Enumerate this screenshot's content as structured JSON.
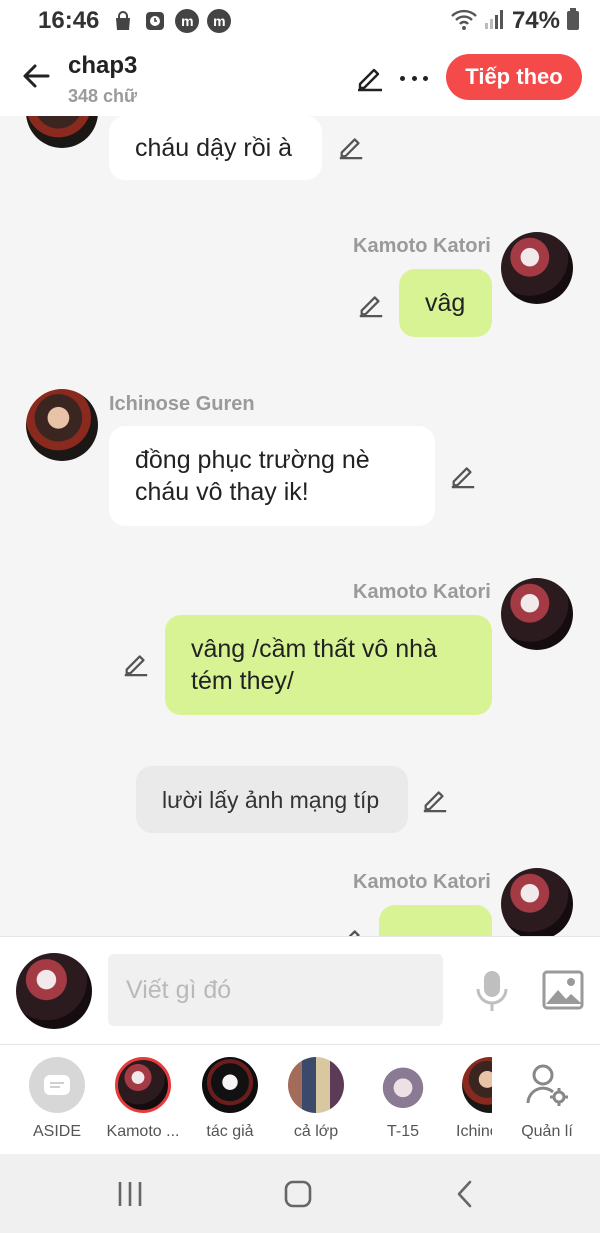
{
  "status_bar": {
    "time": "16:46",
    "battery": "74%",
    "icons": [
      "shopping-bag-icon",
      "clock-app-icon",
      "m-app-icon",
      "m-app-icon-2",
      "wifi-icon",
      "signal-icon",
      "battery-icon"
    ],
    "m_glyph": "m"
  },
  "header": {
    "title": "chap3",
    "word_count": "348 chữ",
    "next_label": "Tiếp theo",
    "next_color": "#f44a4a"
  },
  "messages": [
    {
      "side": "left",
      "sender": "",
      "text": "cháu dậy rồi à",
      "style": "white"
    },
    {
      "side": "right",
      "sender": "Kamoto Katori",
      "text": "vâg",
      "style": "green"
    },
    {
      "side": "left",
      "sender": "Ichinose Guren",
      "text_lines": [
        "đồng phục trường nè",
        "cháu vô thay ik!"
      ],
      "style": "white"
    },
    {
      "side": "right",
      "sender": "Kamoto Katori",
      "text_lines": [
        "vâng /cầm thất vô nhà",
        "tém they/"
      ],
      "style": "green"
    },
    {
      "side": "center",
      "sender": "",
      "text": "lười lấy ảnh mạng típ",
      "style": "gray"
    },
    {
      "side": "right",
      "sender": "Kamoto Katori",
      "text": "",
      "style": "green"
    }
  ],
  "composer": {
    "placeholder": "Viết gì đó"
  },
  "characters": [
    {
      "label": "ASIDE"
    },
    {
      "label": "Kamoto ..."
    },
    {
      "label": "tác giả"
    },
    {
      "label": "cả lớp"
    },
    {
      "label": "T-15"
    },
    {
      "label": "Ichinose"
    },
    {
      "label": "Quản lí"
    }
  ],
  "colors": {
    "accent_red": "#f44a4a",
    "bubble_green": "#d8f394",
    "bubble_white": "#ffffff",
    "aside_gray": "#eaeaea"
  }
}
